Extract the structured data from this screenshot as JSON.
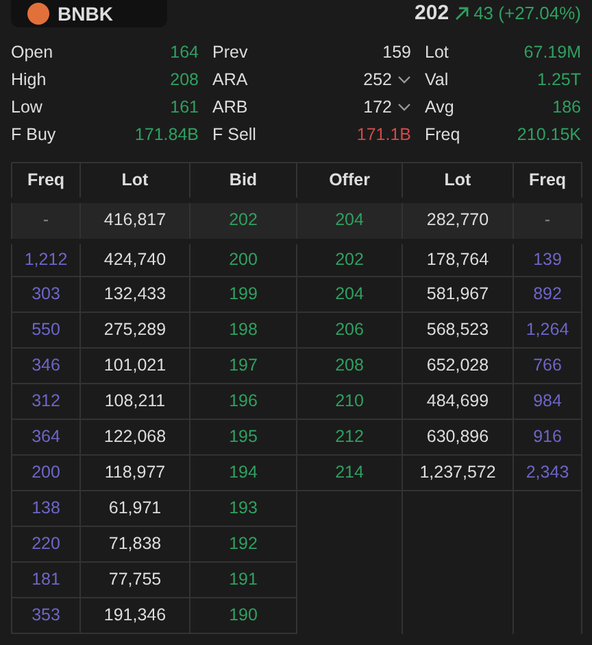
{
  "header": {
    "symbol": "BNBK",
    "price": "202",
    "change": "43 (+27.04%)",
    "rising": true
  },
  "stats": [
    [
      {
        "label": "Open",
        "value": "164",
        "color": "#2fa060"
      },
      {
        "label": "Prev",
        "value": "159",
        "color": "#dddddd"
      },
      {
        "label": "Lot",
        "value": "67.19M",
        "color": "#2fa060"
      }
    ],
    [
      {
        "label": "High",
        "value": "208",
        "color": "#2fa060"
      },
      {
        "label": "ARA",
        "value": "252",
        "color": "#dddddd",
        "dropdown": true
      },
      {
        "label": "Val",
        "value": "1.25T",
        "color": "#2fa060"
      }
    ],
    [
      {
        "label": "Low",
        "value": "161",
        "color": "#2fa060"
      },
      {
        "label": "ARB",
        "value": "172",
        "color": "#dddddd",
        "dropdown": true
      },
      {
        "label": "Avg",
        "value": "186",
        "color": "#2fa060"
      }
    ],
    [
      {
        "label": "F Buy",
        "value": "171.84B",
        "color": "#2fa060"
      },
      {
        "label": "F Sell",
        "value": "171.1B",
        "color": "#d24a4a"
      },
      {
        "label": "Freq",
        "value": "210.15K",
        "color": "#2fa060"
      }
    ]
  ],
  "orderbook": {
    "columns": [
      "Freq",
      "Lot",
      "Bid",
      "Offer",
      "Lot",
      "Freq"
    ],
    "best": [
      "-",
      "416,817",
      "202",
      "204",
      "282,770",
      "-"
    ],
    "rows": [
      [
        "1,212",
        "424,740",
        "200",
        "202",
        "178,764",
        "139"
      ],
      [
        "303",
        "132,433",
        "199",
        "204",
        "581,967",
        "892"
      ],
      [
        "550",
        "275,289",
        "198",
        "206",
        "568,523",
        "1,264"
      ],
      [
        "346",
        "101,021",
        "197",
        "208",
        "652,028",
        "766"
      ],
      [
        "312",
        "108,211",
        "196",
        "210",
        "484,699",
        "984"
      ],
      [
        "364",
        "122,068",
        "195",
        "212",
        "630,896",
        "916"
      ],
      [
        "200",
        "118,977",
        "194",
        "214",
        "1,237,572",
        "2,343"
      ],
      [
        "138",
        "61,971",
        "193"
      ],
      [
        "220",
        "71,838",
        "192"
      ],
      [
        "181",
        "77,755",
        "191"
      ],
      [
        "353",
        "191,346",
        "190"
      ]
    ]
  }
}
